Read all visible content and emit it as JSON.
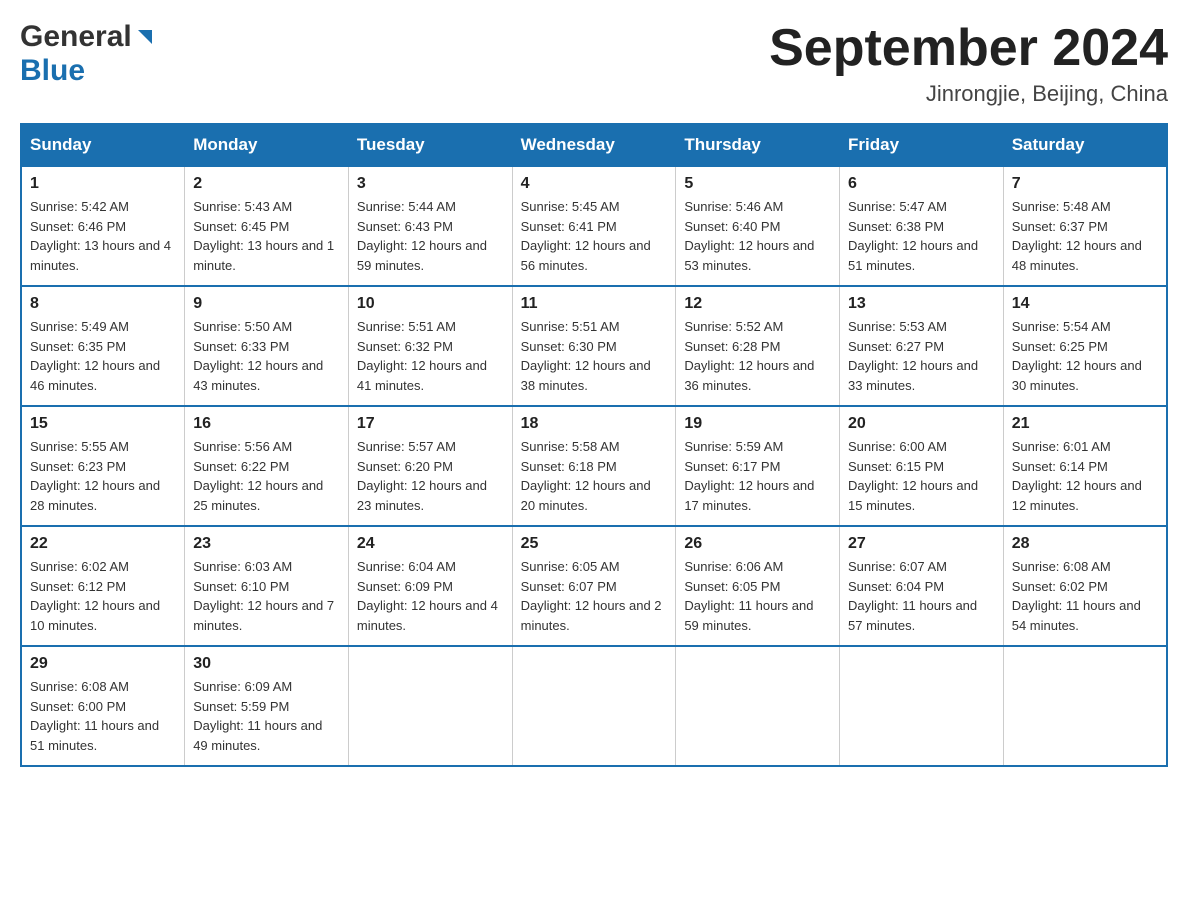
{
  "header": {
    "logo_general": "General",
    "logo_blue": "Blue",
    "month_year": "September 2024",
    "location": "Jinrongjie, Beijing, China"
  },
  "days_of_week": [
    "Sunday",
    "Monday",
    "Tuesday",
    "Wednesday",
    "Thursday",
    "Friday",
    "Saturday"
  ],
  "weeks": [
    [
      {
        "day": "1",
        "sunrise": "5:42 AM",
        "sunset": "6:46 PM",
        "daylight": "13 hours and 4 minutes."
      },
      {
        "day": "2",
        "sunrise": "5:43 AM",
        "sunset": "6:45 PM",
        "daylight": "13 hours and 1 minute."
      },
      {
        "day": "3",
        "sunrise": "5:44 AM",
        "sunset": "6:43 PM",
        "daylight": "12 hours and 59 minutes."
      },
      {
        "day": "4",
        "sunrise": "5:45 AM",
        "sunset": "6:41 PM",
        "daylight": "12 hours and 56 minutes."
      },
      {
        "day": "5",
        "sunrise": "5:46 AM",
        "sunset": "6:40 PM",
        "daylight": "12 hours and 53 minutes."
      },
      {
        "day": "6",
        "sunrise": "5:47 AM",
        "sunset": "6:38 PM",
        "daylight": "12 hours and 51 minutes."
      },
      {
        "day": "7",
        "sunrise": "5:48 AM",
        "sunset": "6:37 PM",
        "daylight": "12 hours and 48 minutes."
      }
    ],
    [
      {
        "day": "8",
        "sunrise": "5:49 AM",
        "sunset": "6:35 PM",
        "daylight": "12 hours and 46 minutes."
      },
      {
        "day": "9",
        "sunrise": "5:50 AM",
        "sunset": "6:33 PM",
        "daylight": "12 hours and 43 minutes."
      },
      {
        "day": "10",
        "sunrise": "5:51 AM",
        "sunset": "6:32 PM",
        "daylight": "12 hours and 41 minutes."
      },
      {
        "day": "11",
        "sunrise": "5:51 AM",
        "sunset": "6:30 PM",
        "daylight": "12 hours and 38 minutes."
      },
      {
        "day": "12",
        "sunrise": "5:52 AM",
        "sunset": "6:28 PM",
        "daylight": "12 hours and 36 minutes."
      },
      {
        "day": "13",
        "sunrise": "5:53 AM",
        "sunset": "6:27 PM",
        "daylight": "12 hours and 33 minutes."
      },
      {
        "day": "14",
        "sunrise": "5:54 AM",
        "sunset": "6:25 PM",
        "daylight": "12 hours and 30 minutes."
      }
    ],
    [
      {
        "day": "15",
        "sunrise": "5:55 AM",
        "sunset": "6:23 PM",
        "daylight": "12 hours and 28 minutes."
      },
      {
        "day": "16",
        "sunrise": "5:56 AM",
        "sunset": "6:22 PM",
        "daylight": "12 hours and 25 minutes."
      },
      {
        "day": "17",
        "sunrise": "5:57 AM",
        "sunset": "6:20 PM",
        "daylight": "12 hours and 23 minutes."
      },
      {
        "day": "18",
        "sunrise": "5:58 AM",
        "sunset": "6:18 PM",
        "daylight": "12 hours and 20 minutes."
      },
      {
        "day": "19",
        "sunrise": "5:59 AM",
        "sunset": "6:17 PM",
        "daylight": "12 hours and 17 minutes."
      },
      {
        "day": "20",
        "sunrise": "6:00 AM",
        "sunset": "6:15 PM",
        "daylight": "12 hours and 15 minutes."
      },
      {
        "day": "21",
        "sunrise": "6:01 AM",
        "sunset": "6:14 PM",
        "daylight": "12 hours and 12 minutes."
      }
    ],
    [
      {
        "day": "22",
        "sunrise": "6:02 AM",
        "sunset": "6:12 PM",
        "daylight": "12 hours and 10 minutes."
      },
      {
        "day": "23",
        "sunrise": "6:03 AM",
        "sunset": "6:10 PM",
        "daylight": "12 hours and 7 minutes."
      },
      {
        "day": "24",
        "sunrise": "6:04 AM",
        "sunset": "6:09 PM",
        "daylight": "12 hours and 4 minutes."
      },
      {
        "day": "25",
        "sunrise": "6:05 AM",
        "sunset": "6:07 PM",
        "daylight": "12 hours and 2 minutes."
      },
      {
        "day": "26",
        "sunrise": "6:06 AM",
        "sunset": "6:05 PM",
        "daylight": "11 hours and 59 minutes."
      },
      {
        "day": "27",
        "sunrise": "6:07 AM",
        "sunset": "6:04 PM",
        "daylight": "11 hours and 57 minutes."
      },
      {
        "day": "28",
        "sunrise": "6:08 AM",
        "sunset": "6:02 PM",
        "daylight": "11 hours and 54 minutes."
      }
    ],
    [
      {
        "day": "29",
        "sunrise": "6:08 AM",
        "sunset": "6:00 PM",
        "daylight": "11 hours and 51 minutes."
      },
      {
        "day": "30",
        "sunrise": "6:09 AM",
        "sunset": "5:59 PM",
        "daylight": "11 hours and 49 minutes."
      },
      null,
      null,
      null,
      null,
      null
    ]
  ],
  "labels": {
    "sunrise_prefix": "Sunrise: ",
    "sunset_prefix": "Sunset: ",
    "daylight_prefix": "Daylight: "
  }
}
